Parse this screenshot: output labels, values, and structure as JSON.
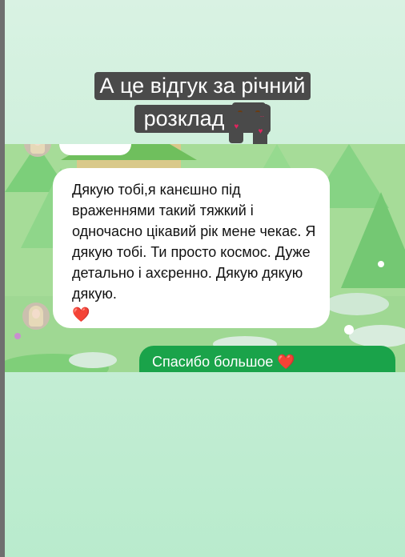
{
  "story": {
    "caption_line1": "А це відгук за річний",
    "caption_line2": "розклад",
    "caption_emoji": "smiling-face-with-hearts-icon"
  },
  "chat": {
    "incoming_message": "Дякую тобі,я канєшно під враженнями такий тяжкий і одночасно цікавий рік мене чекає. Я дякую тобі. Ти просто космос. Дуже детально і ахєренно. Дякую дякую дякую.",
    "incoming_emoji": "❤️",
    "outgoing_message": "Спасибо большое",
    "outgoing_emoji": "❤️"
  },
  "colors": {
    "background": "#cbefd9",
    "outgoing_bubble": "#1aa34a",
    "incoming_bubble": "#ffffff",
    "caption_background": "#4a4a4a"
  }
}
